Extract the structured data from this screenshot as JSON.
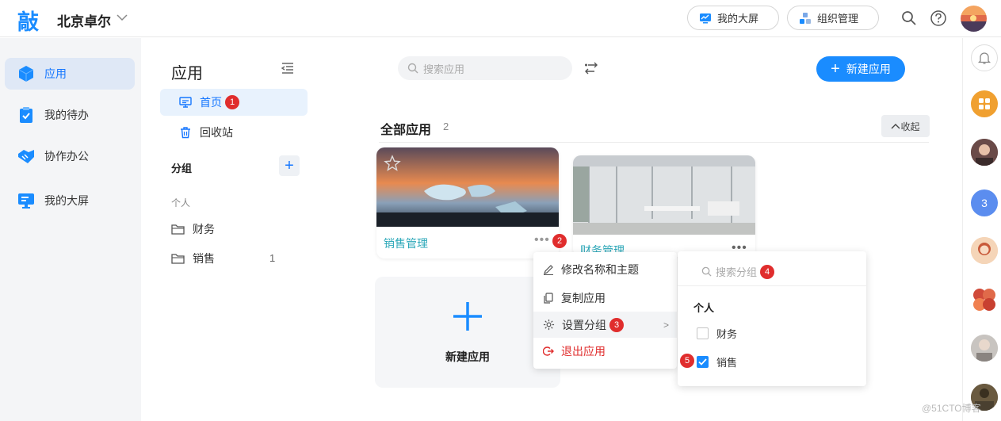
{
  "topbar": {
    "logo": "敲",
    "org_name": "北京卓尔",
    "my_screen_label": "我的大屏",
    "org_manage_label": "组织管理"
  },
  "leftnav": {
    "items": [
      {
        "label": "应用",
        "active": true
      },
      {
        "label": "我的待办",
        "active": false
      },
      {
        "label": "协作办公",
        "active": false
      },
      {
        "label": "我的大屏",
        "active": false
      }
    ]
  },
  "subnav": {
    "title": "应用",
    "items": [
      {
        "label": "首页",
        "badge": "1",
        "active": true
      },
      {
        "label": "回收站",
        "active": false
      }
    ],
    "group_header": "分组",
    "personal_label": "个人",
    "folders": [
      {
        "label": "财务",
        "count": ""
      },
      {
        "label": "销售",
        "count": "1"
      }
    ]
  },
  "main": {
    "search_placeholder": "搜索应用",
    "new_app_button": "新建应用",
    "section_title": "全部应用",
    "section_count": "2",
    "collapse_label": "收起",
    "cards": [
      {
        "label": "销售管理",
        "badge": "2"
      },
      {
        "label": "财务管理"
      }
    ],
    "new_app_card_label": "新建应用"
  },
  "context_menu": {
    "items": [
      {
        "label": "修改名称和主题"
      },
      {
        "label": "复制应用"
      },
      {
        "label": "设置分组",
        "badge": "3"
      },
      {
        "label": "退出应用"
      }
    ]
  },
  "group_submenu": {
    "search_placeholder": "搜索分组",
    "search_badge": "4",
    "group_label": "个人",
    "options": [
      {
        "label": "财务",
        "checked": false
      },
      {
        "label": "销售",
        "checked": true,
        "badge": "5"
      }
    ]
  },
  "rightrail": {
    "badge_number": "3"
  },
  "watermark": "@51CTO博客",
  "colors": {
    "accent": "#1a8cff",
    "danger": "#e02d2d",
    "teal": "#2aa7b8",
    "orange": "#f0a030"
  }
}
